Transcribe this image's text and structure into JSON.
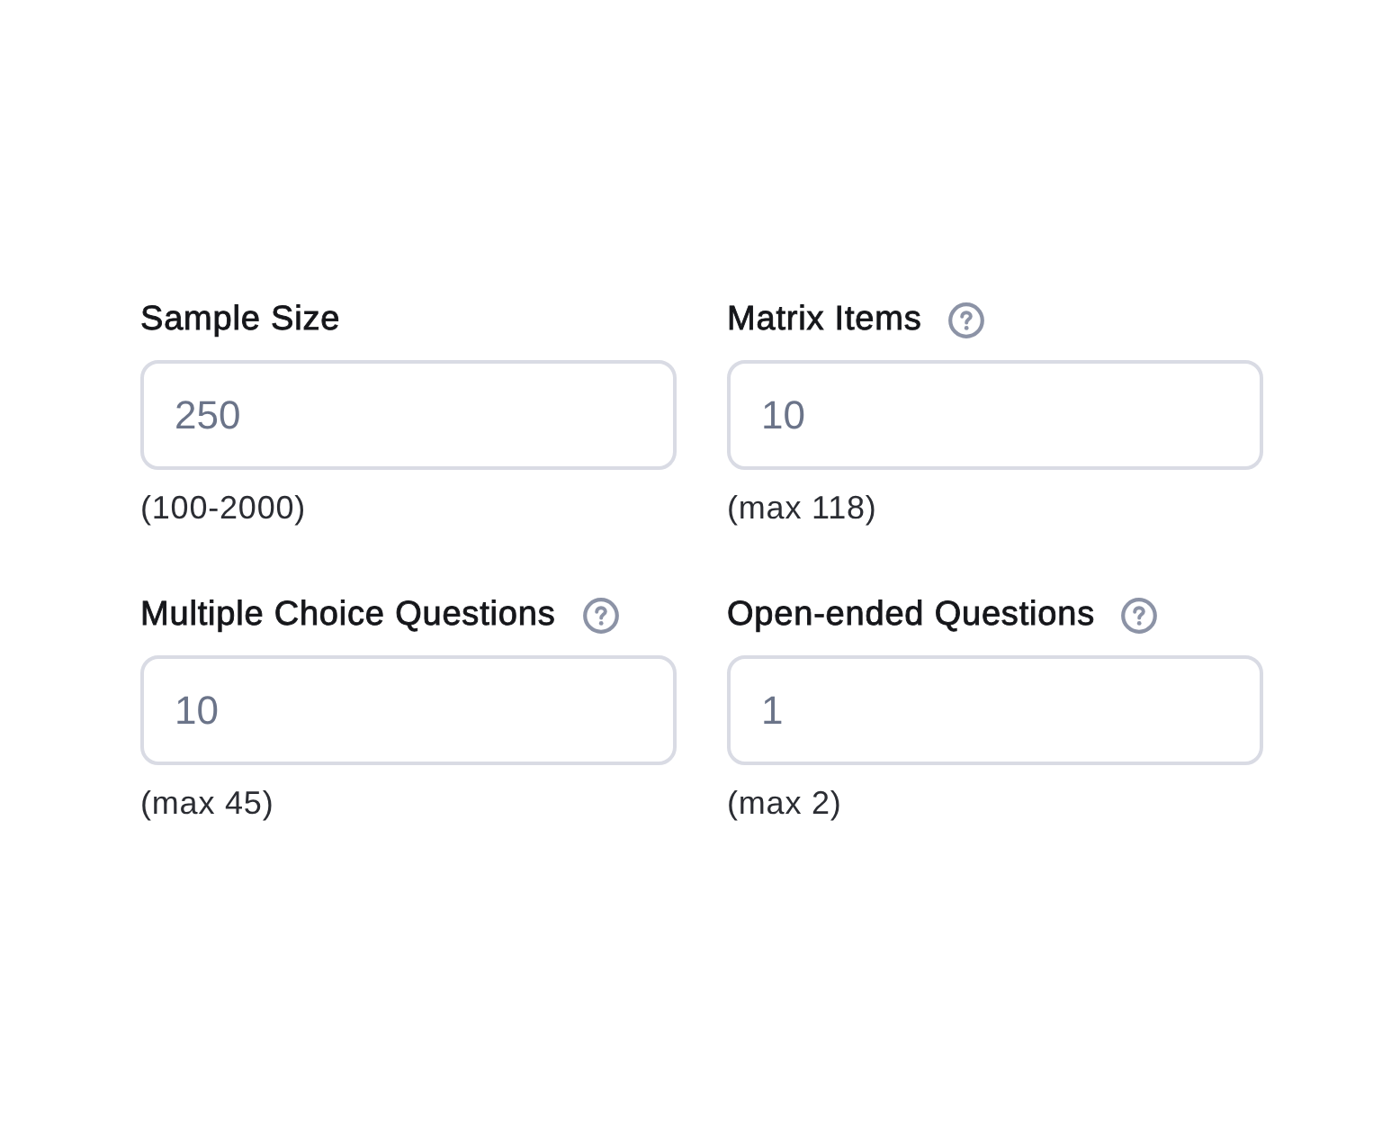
{
  "fields": [
    {
      "label": "Sample Size",
      "help": false,
      "value": "250",
      "hint": "(100-2000)"
    },
    {
      "label": "Matrix Items",
      "help": true,
      "value": "10",
      "hint": "(max 118)"
    },
    {
      "label": "Multiple Choice Questions",
      "help": true,
      "value": "10",
      "hint": "(max 45)"
    },
    {
      "label": "Open-ended Questions",
      "help": true,
      "value": "1",
      "hint": "(max 2)"
    }
  ]
}
